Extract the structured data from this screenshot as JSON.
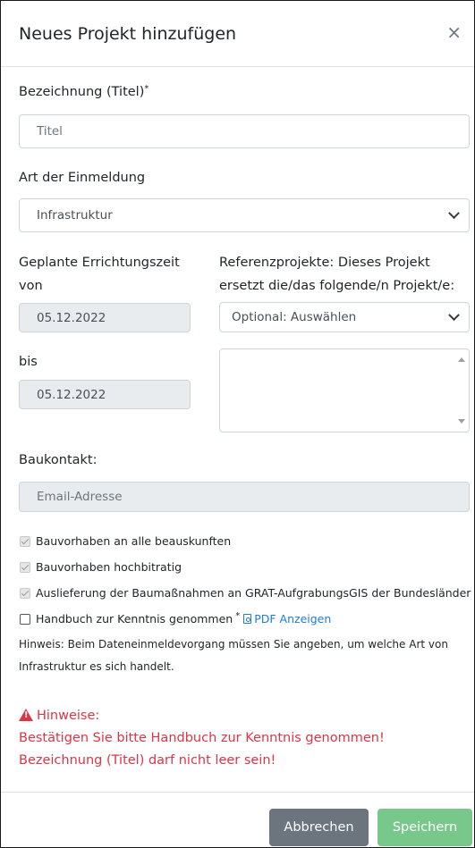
{
  "modal": {
    "title": "Neues Projekt hinzufügen",
    "close_label": "×"
  },
  "form": {
    "title_label": "Bezeichnung (Titel)",
    "required_mark": "*",
    "title_placeholder": "Titel",
    "art_label": "Art der Einmeldung",
    "art_value": "Infrastruktur",
    "zeit_label_line1": "Geplante Errichtungszeit",
    "zeit_label_line2": "von",
    "von_value": "05.12.2022",
    "bis_label": "bis",
    "bis_value": "05.12.2022",
    "ref_label_line1": "Referenzprojekte: Dieses Projekt",
    "ref_label_line2": "ersetzt die/das folgende/n Projekt/e:",
    "ref_select_value": "Optional: Auswählen",
    "baukontakt_label": "Baukontakt:",
    "email_placeholder": "Email-Adresse"
  },
  "checkboxes": [
    {
      "label": "Bauvorhaben an alle beauskunften",
      "checked": true,
      "disabled": true
    },
    {
      "label": "Bauvorhaben hochbitratig",
      "checked": true,
      "disabled": true
    },
    {
      "label": "Auslieferung der Baumaßnahmen an GRAT-AufgrabungsGIS der Bundesländer",
      "checked": true,
      "disabled": true
    },
    {
      "label": "Handbuch zur Kenntnis genommen",
      "checked": false,
      "disabled": false
    }
  ],
  "pdf_link": "PDF Anzeigen",
  "hint_text": "Hinweis: Beim Dateneinmeldevorgang müssen Sie angeben, um welche Art von Infrastruktur es sich handelt.",
  "warnings": {
    "title": "Hinweise:",
    "lines": [
      "Bestätigen Sie bitte Handbuch zur Kenntnis genommen!",
      "Bezeichnung (Titel) darf nicht leer sein!"
    ]
  },
  "footer": {
    "cancel_label": "Abbrechen",
    "save_label": "Speichern"
  },
  "colors": {
    "danger": "#dc3545",
    "link": "#1f7bd6",
    "cancel_bg": "#6c757d",
    "save_bg": "#79c88b"
  }
}
